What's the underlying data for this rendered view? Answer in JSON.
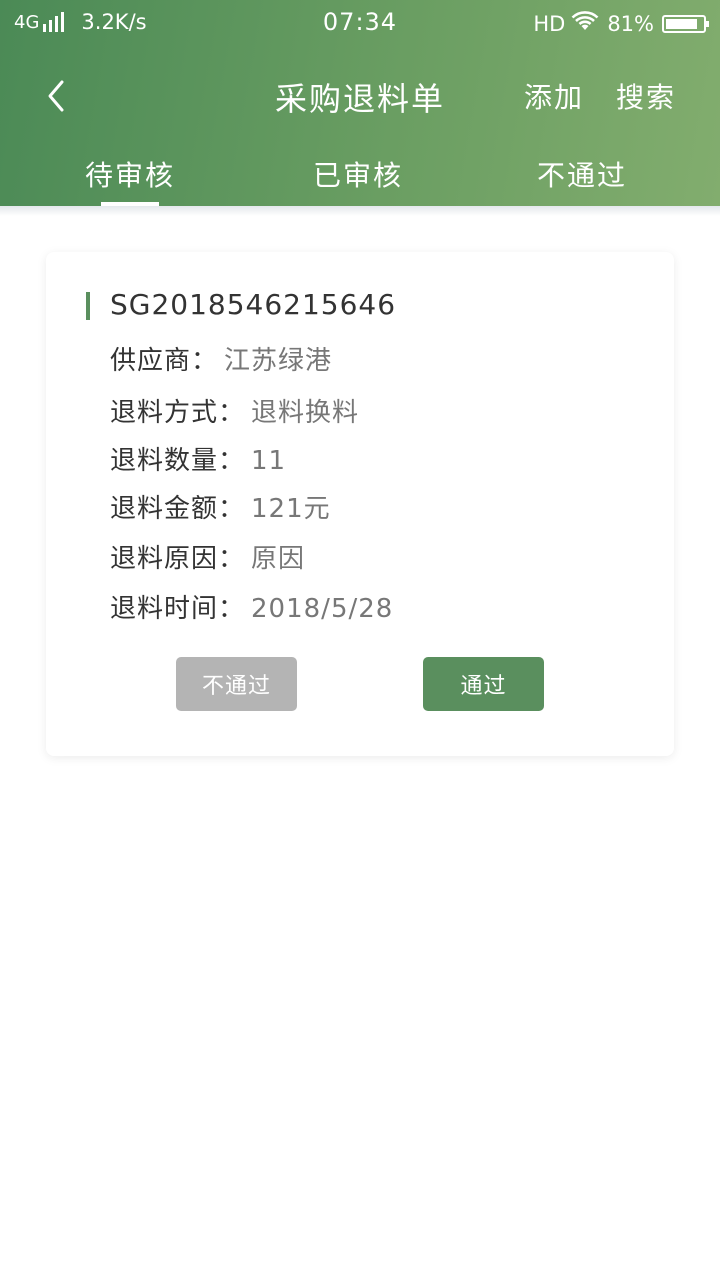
{
  "status_bar": {
    "network": "4G",
    "speed": "3.2K/s",
    "time": "07:34",
    "hd": "HD",
    "battery": "81%"
  },
  "header": {
    "title": "采购退料单",
    "add_label": "添加",
    "search_label": "搜索",
    "back_icon": "chevron-left-icon"
  },
  "tabs": [
    {
      "label": "待审核",
      "active": true
    },
    {
      "label": "已审核",
      "active": false
    },
    {
      "label": "不通过",
      "active": false
    }
  ],
  "orders": [
    {
      "number": "SG2018546215646",
      "supplier_label": "供应商：",
      "supplier": "江苏绿港",
      "method_label": "退料方式：",
      "method": "退料换料",
      "qty_label": "退料数量：",
      "qty": "11",
      "amount_label": "退料金额：",
      "amount": "121元",
      "reason_label": "退料原因：",
      "reason": "原因",
      "time_label": "退料时间：",
      "time": "2018/5/28",
      "reject_label": "不通过",
      "approve_label": "通过"
    }
  ],
  "colors": {
    "header_start": "#4b8a56",
    "header_end": "#82ad6e",
    "accent": "#5a8f5e",
    "reject_button": "#b4b4b4"
  }
}
